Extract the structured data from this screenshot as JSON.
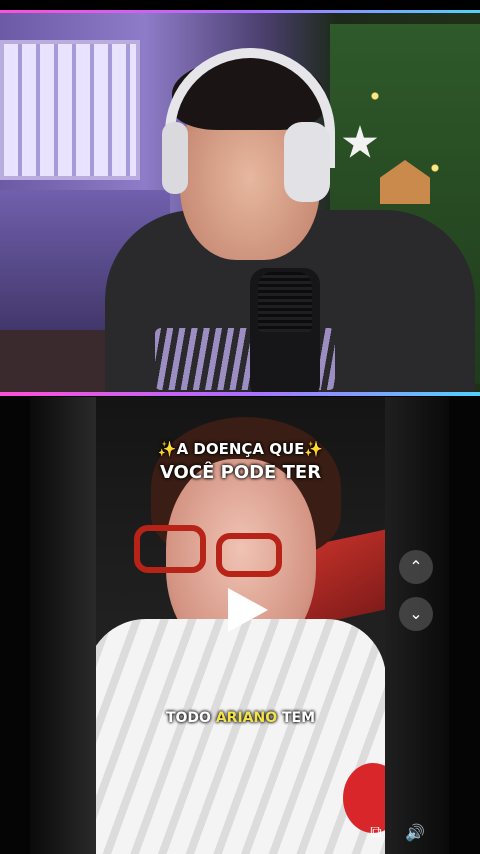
{
  "top_stream": {
    "accent_colors": [
      "#ff4fd8",
      "#b06cff",
      "#4fd2ff"
    ]
  },
  "reel": {
    "caption_top": {
      "sparkle_left": "✨",
      "line1_text": "A DOENÇA QUE",
      "sparkle_right": "✨",
      "line2": "VOCÊ PODE TER"
    },
    "caption_bottom": {
      "before": "TODO",
      "highlight": "ARIANO",
      "after": "TEM",
      "highlight_color": "#f3e24a"
    },
    "controls": {
      "play_icon": "play-icon",
      "up_icon": "chevron-up-icon",
      "down_icon": "chevron-down-icon",
      "up_glyph": "⌃",
      "down_glyph": "⌄",
      "pip_glyph": "⧉",
      "sound_glyph": "🔊"
    }
  }
}
